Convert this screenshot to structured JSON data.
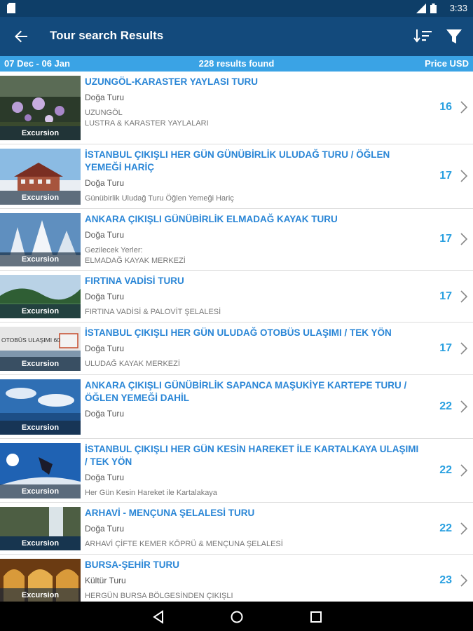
{
  "status": {
    "time": "3:33"
  },
  "appbar": {
    "title": "Tour search Results"
  },
  "infobar": {
    "dates": "07 Dec - 06 Jan",
    "results": "228 results found",
    "price_label": "Price USD"
  },
  "items": [
    {
      "title": "UZUNGÖL-KARASTER YAYLASI TURU",
      "type": "Doğa Turu",
      "subtitle": "UZUNGÖL\nLUSTRA & KARASTER YAYLALARI",
      "price": "16",
      "badge": "Excursion",
      "thumb_text": ""
    },
    {
      "title": "İSTANBUL ÇIKIŞLI HER GÜN GÜNÜBİRLİK ULUDAĞ TURU / ÖĞLEN YEMEĞİ HARİÇ",
      "type": "Doğa Turu",
      "subtitle": "Günübirlik Uludağ Turu Öğlen Yemeği Hariç",
      "price": "17",
      "badge": "Excursion",
      "thumb_text": ""
    },
    {
      "title": "ANKARA ÇIKIŞLI GÜNÜBİRLİK ELMADAĞ KAYAK TURU",
      "type": "Doğa Turu",
      "subtitle": "Gezilecek Yerler:\nELMADAĞ KAYAK MERKEZİ",
      "price": "17",
      "badge": "Excursion",
      "thumb_text": ""
    },
    {
      "title": "FIRTINA VADİSİ TURU",
      "type": "Doğa Turu",
      "subtitle": "FIRTINA VADİSİ & PALOVİT ŞELALESİ",
      "price": "17",
      "badge": "Excursion",
      "thumb_text": ""
    },
    {
      "title": "İSTANBUL ÇIKIŞLI HER GÜN ULUDAĞ OTOBÜS ULAŞIMI / TEK YÖN",
      "type": "Doğa Turu",
      "subtitle": "ULUDAĞ KAYAK MERKEZİ",
      "price": "17",
      "badge": "Excursion",
      "thumb_text": "OTOBÜS ULAŞIMI 60"
    },
    {
      "title": "ANKARA ÇIKIŞLI GÜNÜBİRLİK SAPANCA MAŞUKİYE KARTEPE TURU / ÖĞLEN YEMEĞİ DAHİL",
      "type": "Doğa Turu",
      "subtitle": "",
      "price": "22",
      "badge": "Excursion",
      "thumb_text": ""
    },
    {
      "title": "İSTANBUL ÇIKIŞLI HER GÜN KESİN HAREKET İLE KARTALKAYA ULAŞIMI / TEK YÖN",
      "type": "Doğa Turu",
      "subtitle": "Her Gün Kesin Hareket ile Kartalakaya",
      "price": "22",
      "badge": "Excursion",
      "thumb_text": ""
    },
    {
      "title": "ARHAVİ - MENÇUNA ŞELALESİ TURU",
      "type": "Doğa Turu",
      "subtitle": "ARHAVİ ÇİFTE KEMER KÖPRÜ & MENÇUNA ŞELALESİ",
      "price": "22",
      "badge": "Excursion",
      "thumb_text": ""
    },
    {
      "title": "BURSA-ŞEHİR TURU",
      "type": "Kültür Turu",
      "subtitle": "HERGÜN BURSA BÖLGESİNDEN ÇIKIŞLI",
      "price": "23",
      "badge": "Excursion",
      "thumb_text": ""
    }
  ]
}
